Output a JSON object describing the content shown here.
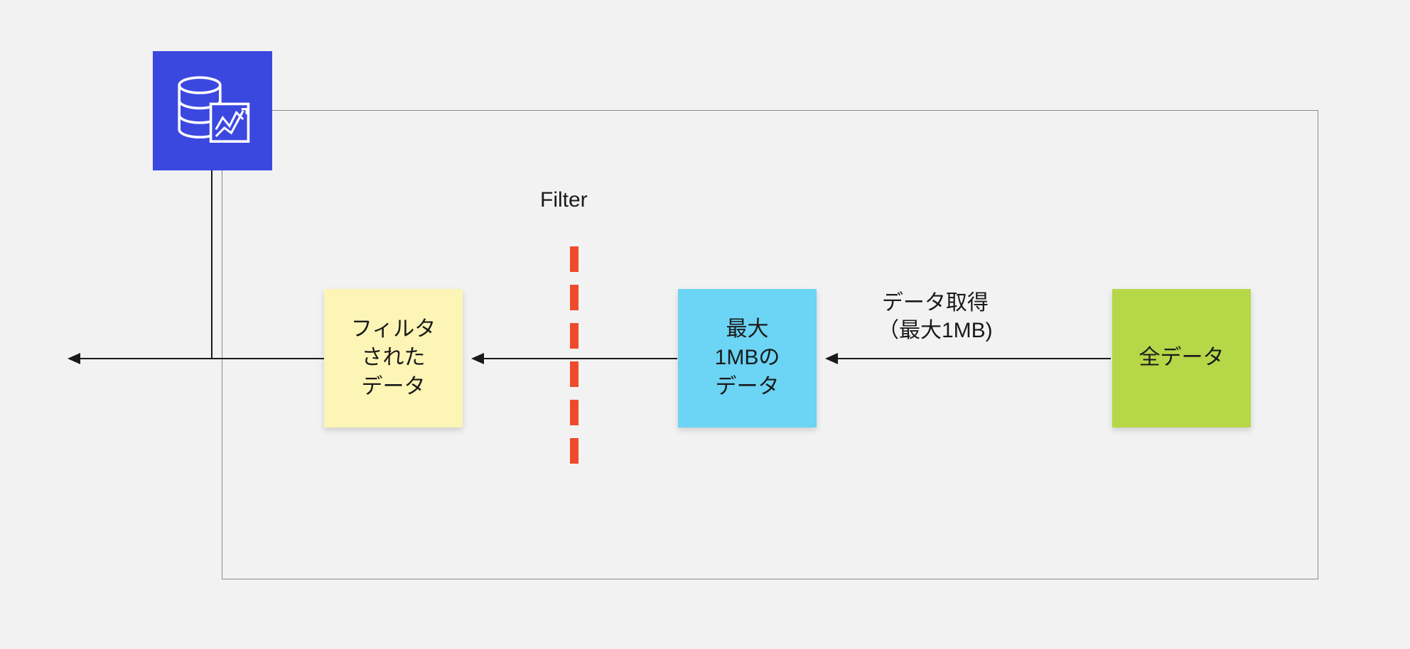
{
  "diagram": {
    "container_label": "",
    "icon_name": "database-analytics-icon",
    "filter_label": "Filter",
    "notes": {
      "filtered": "フィルタ\nされた\nデータ",
      "max1mb": "最大\n1MBの\nデータ",
      "alldata": "全データ"
    },
    "arrows": {
      "fetch_label": "データ取得\n（最大1MB)"
    },
    "colors": {
      "icon_bg": "#3b48e0",
      "note_yellow": "#fdf5b5",
      "note_blue": "#6cd4f4",
      "note_green": "#b6d747",
      "filter_dash": "#ee4b2b"
    }
  }
}
